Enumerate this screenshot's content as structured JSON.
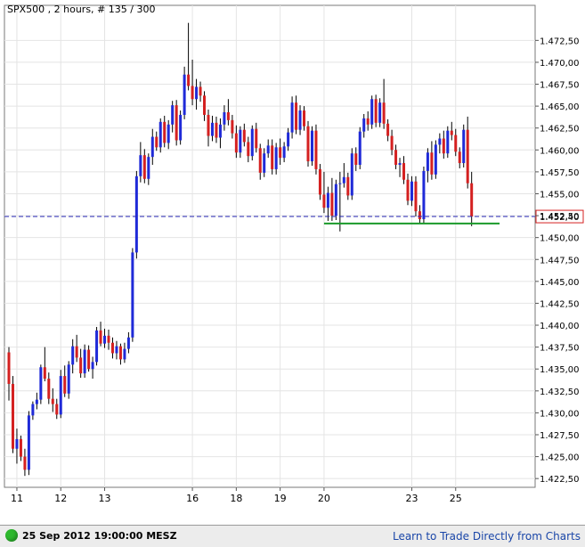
{
  "colors": {
    "bull": "#1f2ad8",
    "bear": "#d42020",
    "grid": "#e4e4e4",
    "frame": "#7a7a7a",
    "current_line": "#2a2ab8",
    "support_line": "#1a9a2a",
    "price_tag_border": "#d42020"
  },
  "footer": {
    "datetime": "25 Sep 2012 19:00:00 MESZ",
    "link": "Learn to Trade Directly from Charts",
    "status_icon": "green-circle-icon"
  },
  "chart_data": {
    "type": "candlestick",
    "title": "SPX500 , 2 hours, # 135 / 300",
    "ylim": [
      1421.5,
      1476.5
    ],
    "y_ticks": [
      1422.5,
      1425.0,
      1427.5,
      1430.0,
      1432.5,
      1435.0,
      1437.5,
      1440.0,
      1442.5,
      1445.0,
      1447.5,
      1450.0,
      1452.5,
      1455.0,
      1457.5,
      1460.0,
      1462.5,
      1465.0,
      1467.5,
      1470.0,
      1472.5
    ],
    "y_tick_labels": [
      "1.422,50",
      "1.425,00",
      "1.427,50",
      "1.430,00",
      "1.432,50",
      "1.435,00",
      "1.437,50",
      "1.440,00",
      "1.442,50",
      "1.445,00",
      "1.447,50",
      "1.450,00",
      "1.452,50",
      "1.455,00",
      "1.457,50",
      "1.460,00",
      "1.462,50",
      "1.465,00",
      "1.467,50",
      "1.470,00",
      "1.472,50"
    ],
    "x_ticks": [
      {
        "label": "11",
        "bar": 2
      },
      {
        "label": "12",
        "bar": 13
      },
      {
        "label": "13",
        "bar": 24
      },
      {
        "label": "16",
        "bar": 46
      },
      {
        "label": "18",
        "bar": 57
      },
      {
        "label": "19",
        "bar": 68
      },
      {
        "label": "20",
        "bar": 79
      },
      {
        "label": "23",
        "bar": 101
      },
      {
        "label": "25",
        "bar": 112
      }
    ],
    "current_price": 1452.4,
    "current_price_label": "1.452,40",
    "support_level": 1451.6,
    "support_bars": [
      79,
      123
    ],
    "candles": [
      [
        1436.9,
        1437.5,
        1431.4,
        1433.3
      ],
      [
        1433.3,
        1434.2,
        1425.4,
        1425.9
      ],
      [
        1425.9,
        1428.2,
        1424.2,
        1427.0
      ],
      [
        1427.0,
        1427.4,
        1424.5,
        1425.0
      ],
      [
        1425.0,
        1425.9,
        1422.8,
        1423.5
      ],
      [
        1423.5,
        1430.2,
        1422.9,
        1429.7
      ],
      [
        1429.7,
        1431.3,
        1429.2,
        1431.0
      ],
      [
        1431.0,
        1432.3,
        1430.4,
        1431.5
      ],
      [
        1431.5,
        1435.5,
        1431.0,
        1435.2
      ],
      [
        1435.2,
        1437.5,
        1433.6,
        1433.9
      ],
      [
        1433.9,
        1434.6,
        1431.0,
        1431.6
      ],
      [
        1431.6,
        1432.8,
        1430.1,
        1431.0
      ],
      [
        1431.0,
        1431.6,
        1429.3,
        1429.8
      ],
      [
        1429.8,
        1434.9,
        1429.4,
        1434.2
      ],
      [
        1434.2,
        1435.4,
        1431.8,
        1432.2
      ],
      [
        1432.2,
        1435.9,
        1431.6,
        1435.5
      ],
      [
        1435.5,
        1438.4,
        1434.5,
        1437.6
      ],
      [
        1437.6,
        1438.9,
        1435.8,
        1436.3
      ],
      [
        1436.3,
        1437.3,
        1434.0,
        1434.5
      ],
      [
        1434.5,
        1437.8,
        1434.0,
        1437.2
      ],
      [
        1437.2,
        1437.7,
        1434.7,
        1435.0
      ],
      [
        1435.0,
        1436.4,
        1433.9,
        1435.8
      ],
      [
        1435.8,
        1439.8,
        1435.4,
        1439.4
      ],
      [
        1439.4,
        1440.4,
        1437.6,
        1437.9
      ],
      [
        1437.9,
        1439.6,
        1437.4,
        1438.8
      ],
      [
        1438.8,
        1439.5,
        1437.2,
        1438.0
      ],
      [
        1438.0,
        1438.6,
        1436.2,
        1436.8
      ],
      [
        1436.8,
        1438.2,
        1436.1,
        1437.6
      ],
      [
        1437.6,
        1437.9,
        1435.5,
        1436.1
      ],
      [
        1436.1,
        1438.0,
        1435.7,
        1437.3
      ],
      [
        1437.3,
        1439.2,
        1436.8,
        1438.6
      ],
      [
        1438.6,
        1448.8,
        1438.1,
        1448.3
      ],
      [
        1448.3,
        1457.6,
        1447.6,
        1457.0
      ],
      [
        1457.0,
        1460.9,
        1456.3,
        1459.4
      ],
      [
        1459.4,
        1460.1,
        1456.2,
        1456.7
      ],
      [
        1456.7,
        1459.6,
        1456.0,
        1459.2
      ],
      [
        1459.2,
        1462.4,
        1458.3,
        1461.5
      ],
      [
        1461.5,
        1462.1,
        1459.9,
        1460.3
      ],
      [
        1460.3,
        1463.6,
        1459.7,
        1463.2
      ],
      [
        1463.2,
        1463.9,
        1460.3,
        1460.8
      ],
      [
        1460.8,
        1463.4,
        1460.1,
        1462.9
      ],
      [
        1462.9,
        1465.6,
        1462.0,
        1465.1
      ],
      [
        1465.1,
        1465.7,
        1460.5,
        1461.1
      ],
      [
        1461.1,
        1464.5,
        1460.6,
        1464.0
      ],
      [
        1464.0,
        1469.5,
        1463.5,
        1468.6
      ],
      [
        1468.6,
        1474.5,
        1466.8,
        1467.3
      ],
      [
        1467.3,
        1470.3,
        1465.1,
        1465.8
      ],
      [
        1465.8,
        1468.1,
        1464.6,
        1467.2
      ],
      [
        1467.2,
        1467.8,
        1465.5,
        1466.2
      ],
      [
        1466.2,
        1466.7,
        1463.3,
        1464.0
      ],
      [
        1464.0,
        1464.6,
        1460.4,
        1461.6
      ],
      [
        1461.6,
        1463.9,
        1461.0,
        1463.1
      ],
      [
        1463.1,
        1463.8,
        1460.8,
        1461.4
      ],
      [
        1461.4,
        1463.6,
        1460.2,
        1462.9
      ],
      [
        1462.9,
        1465.1,
        1462.2,
        1464.3
      ],
      [
        1464.3,
        1465.8,
        1462.8,
        1463.4
      ],
      [
        1463.4,
        1464.0,
        1461.3,
        1461.9
      ],
      [
        1461.9,
        1462.8,
        1459.1,
        1459.7
      ],
      [
        1459.7,
        1462.7,
        1459.1,
        1462.3
      ],
      [
        1462.3,
        1463.0,
        1460.4,
        1460.9
      ],
      [
        1460.9,
        1461.5,
        1458.6,
        1459.3
      ],
      [
        1459.3,
        1462.8,
        1458.8,
        1462.4
      ],
      [
        1462.4,
        1463.1,
        1459.7,
        1460.2
      ],
      [
        1460.2,
        1460.7,
        1456.6,
        1457.4
      ],
      [
        1457.4,
        1460.2,
        1456.9,
        1459.6
      ],
      [
        1459.6,
        1461.2,
        1459.1,
        1460.5
      ],
      [
        1460.5,
        1461.2,
        1457.2,
        1457.8
      ],
      [
        1457.8,
        1460.8,
        1457.2,
        1460.3
      ],
      [
        1460.3,
        1461.3,
        1458.3,
        1459.1
      ],
      [
        1459.1,
        1460.9,
        1458.6,
        1460.4
      ],
      [
        1460.4,
        1462.5,
        1459.9,
        1462.0
      ],
      [
        1462.0,
        1466.1,
        1461.3,
        1465.4
      ],
      [
        1465.4,
        1466.2,
        1461.8,
        1462.3
      ],
      [
        1462.3,
        1465.1,
        1461.7,
        1464.5
      ],
      [
        1464.5,
        1465.0,
        1462.2,
        1462.7
      ],
      [
        1462.7,
        1463.3,
        1458.1,
        1458.7
      ],
      [
        1458.7,
        1462.7,
        1458.2,
        1462.2
      ],
      [
        1462.2,
        1462.9,
        1457.2,
        1457.8
      ],
      [
        1457.8,
        1458.4,
        1454.3,
        1454.9
      ],
      [
        1454.9,
        1457.5,
        1452.8,
        1453.4
      ],
      [
        1453.4,
        1455.8,
        1451.9,
        1455.1
      ],
      [
        1455.1,
        1456.8,
        1451.9,
        1452.5
      ],
      [
        1452.5,
        1456.6,
        1452.0,
        1456.1
      ],
      [
        1456.1,
        1457.5,
        1450.7,
        1456.2
      ],
      [
        1456.2,
        1458.5,
        1455.7,
        1456.9
      ],
      [
        1456.9,
        1457.4,
        1454.3,
        1454.8
      ],
      [
        1454.8,
        1460.2,
        1454.3,
        1459.6
      ],
      [
        1459.6,
        1460.3,
        1457.6,
        1458.3
      ],
      [
        1458.3,
        1462.6,
        1457.8,
        1462.1
      ],
      [
        1462.1,
        1464.1,
        1461.4,
        1463.6
      ],
      [
        1463.6,
        1464.4,
        1462.2,
        1462.9
      ],
      [
        1462.9,
        1466.2,
        1462.4,
        1465.8
      ],
      [
        1465.8,
        1466.3,
        1462.6,
        1463.1
      ],
      [
        1463.1,
        1465.9,
        1462.6,
        1465.4
      ],
      [
        1465.4,
        1468.1,
        1462.4,
        1463.0
      ],
      [
        1463.0,
        1463.5,
        1461.0,
        1461.6
      ],
      [
        1461.6,
        1462.3,
        1459.4,
        1460.0
      ],
      [
        1460.0,
        1460.6,
        1457.8,
        1458.3
      ],
      [
        1458.3,
        1459.1,
        1456.9,
        1458.5
      ],
      [
        1458.5,
        1459.3,
        1456.1,
        1456.6
      ],
      [
        1456.6,
        1457.3,
        1453.7,
        1454.2
      ],
      [
        1454.2,
        1457.0,
        1453.6,
        1456.4
      ],
      [
        1456.4,
        1457.0,
        1452.4,
        1453.0
      ],
      [
        1453.0,
        1453.7,
        1451.6,
        1452.1
      ],
      [
        1452.1,
        1458.1,
        1451.6,
        1457.6
      ],
      [
        1457.6,
        1460.2,
        1456.3,
        1459.7
      ],
      [
        1459.7,
        1461.0,
        1456.6,
        1457.2
      ],
      [
        1457.2,
        1461.1,
        1456.7,
        1460.6
      ],
      [
        1460.6,
        1461.9,
        1459.6,
        1461.3
      ],
      [
        1461.3,
        1462.2,
        1459.0,
        1459.6
      ],
      [
        1459.6,
        1462.7,
        1459.1,
        1462.2
      ],
      [
        1462.2,
        1463.2,
        1461.1,
        1461.7
      ],
      [
        1461.7,
        1462.4,
        1459.3,
        1459.8
      ],
      [
        1459.8,
        1460.3,
        1457.9,
        1458.5
      ],
      [
        1458.5,
        1462.9,
        1458.0,
        1462.3
      ],
      [
        1462.3,
        1463.8,
        1455.6,
        1456.2
      ],
      [
        1456.2,
        1457.5,
        1451.3,
        1452.4
      ]
    ]
  }
}
